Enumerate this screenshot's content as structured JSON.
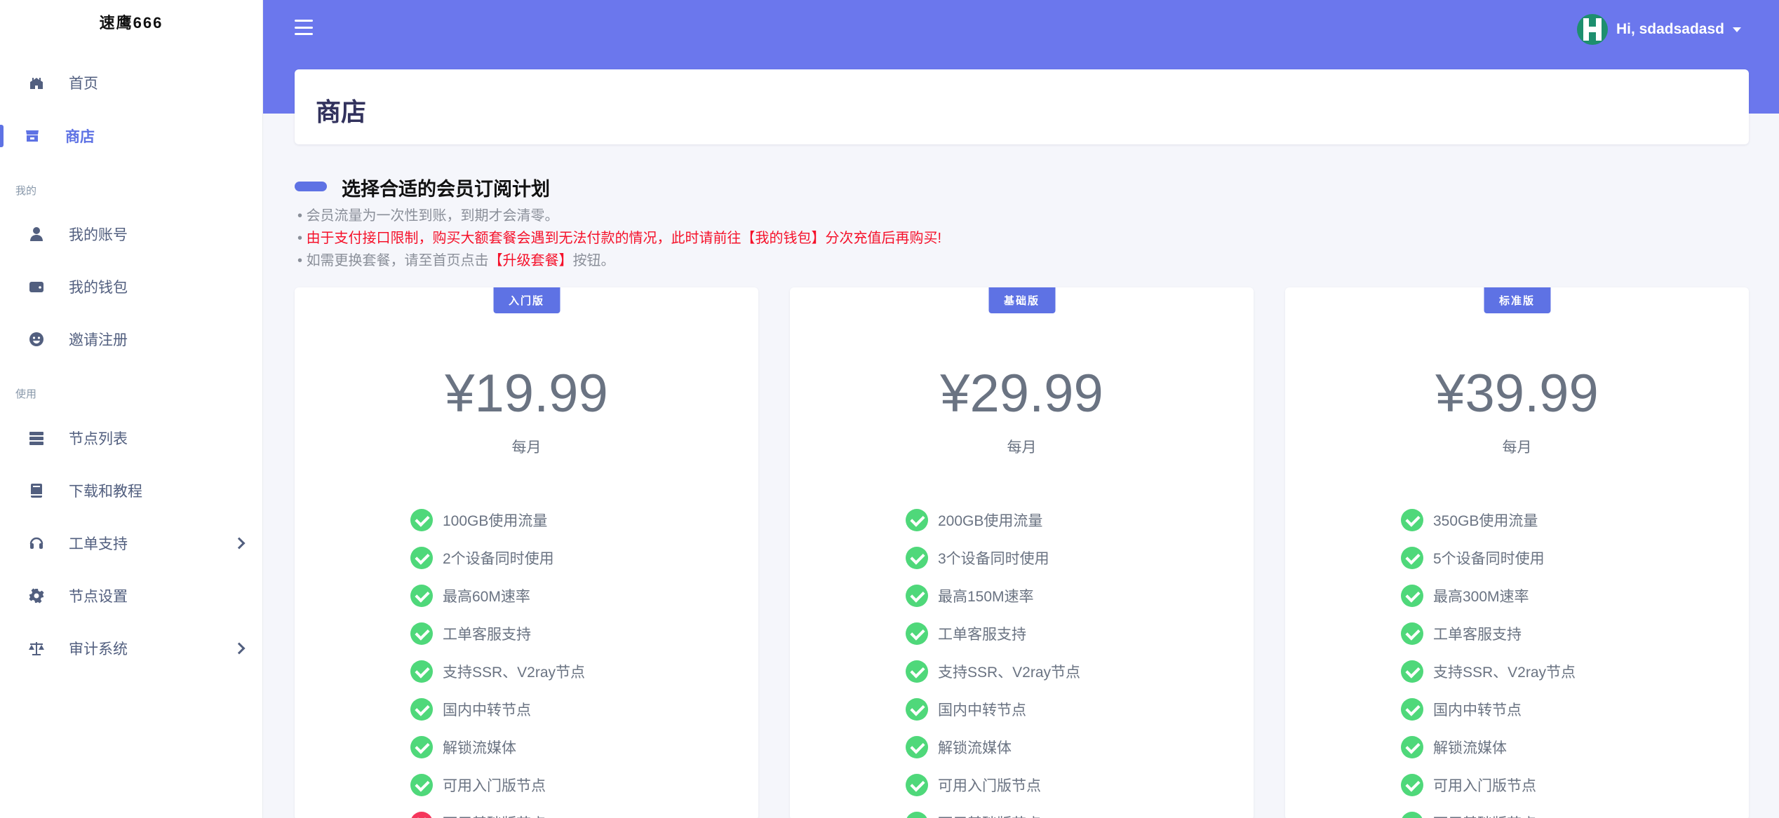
{
  "brand": "速鹰666",
  "colors": {
    "accent": "#5e72e4",
    "header_bg": "#6b77ed",
    "check": "#4fd87a",
    "cross": "#f5365c",
    "warning_text": "#f5112a"
  },
  "sidebar": {
    "items": [
      {
        "label": "首页",
        "icon": "home-icon"
      },
      {
        "label": "商店",
        "icon": "store-icon",
        "active": true
      }
    ],
    "section_mine": "我的",
    "mine_items": [
      {
        "label": "我的账号",
        "icon": "user-icon"
      },
      {
        "label": "我的钱包",
        "icon": "wallet-icon"
      },
      {
        "label": "邀请注册",
        "icon": "smile-icon"
      }
    ],
    "section_use": "使用",
    "use_items": [
      {
        "label": "节点列表",
        "icon": "server-icon"
      },
      {
        "label": "下载和教程",
        "icon": "book-icon"
      },
      {
        "label": "工单支持",
        "icon": "headset-icon",
        "has_submenu": true
      },
      {
        "label": "节点设置",
        "icon": "gear-icon"
      },
      {
        "label": "审计系统",
        "icon": "scale-icon",
        "has_submenu": true
      }
    ]
  },
  "header": {
    "user_greeting": "Hi, sdadsadasd"
  },
  "page": {
    "title": "商店",
    "intro_title": "选择合适的会员订阅计划",
    "notes": {
      "note1": "会员流量为一次性到账，到期才会清零。",
      "note2": "由于支付接口限制，购买大额套餐会遇到无法付款的情况，此时请前往【我的钱包】分次充值后再购买!",
      "note3_pre": "如需更换套餐，请至首页点击",
      "note3_link": "【升级套餐】",
      "note3_post": "按钮。"
    }
  },
  "plans": [
    {
      "badge": "入门版",
      "price": "¥19.99",
      "period": "每月",
      "features": [
        {
          "text": "100GB使用流量",
          "ok": true
        },
        {
          "text": "2个设备同时使用",
          "ok": true
        },
        {
          "text": "最高60M速率",
          "ok": true
        },
        {
          "text": "工单客服支持",
          "ok": true
        },
        {
          "text": "支持SSR、V2ray节点",
          "ok": true
        },
        {
          "text": "国内中转节点",
          "ok": true
        },
        {
          "text": "解锁流媒体",
          "ok": true
        },
        {
          "text": "可用入门版节点",
          "ok": true
        },
        {
          "text": "可用基础版节点",
          "ok": false
        }
      ]
    },
    {
      "badge": "基础版",
      "price": "¥29.99",
      "period": "每月",
      "features": [
        {
          "text": "200GB使用流量",
          "ok": true
        },
        {
          "text": "3个设备同时使用",
          "ok": true
        },
        {
          "text": "最高150M速率",
          "ok": true
        },
        {
          "text": "工单客服支持",
          "ok": true
        },
        {
          "text": "支持SSR、V2ray节点",
          "ok": true
        },
        {
          "text": "国内中转节点",
          "ok": true
        },
        {
          "text": "解锁流媒体",
          "ok": true
        },
        {
          "text": "可用入门版节点",
          "ok": true
        },
        {
          "text": "可用基础版节点",
          "ok": true
        }
      ]
    },
    {
      "badge": "标准版",
      "price": "¥39.99",
      "period": "每月",
      "features": [
        {
          "text": "350GB使用流量",
          "ok": true
        },
        {
          "text": "5个设备同时使用",
          "ok": true
        },
        {
          "text": "最高300M速率",
          "ok": true
        },
        {
          "text": "工单客服支持",
          "ok": true
        },
        {
          "text": "支持SSR、V2ray节点",
          "ok": true
        },
        {
          "text": "国内中转节点",
          "ok": true
        },
        {
          "text": "解锁流媒体",
          "ok": true
        },
        {
          "text": "可用入门版节点",
          "ok": true
        },
        {
          "text": "可用基础版节点",
          "ok": true
        }
      ]
    }
  ]
}
